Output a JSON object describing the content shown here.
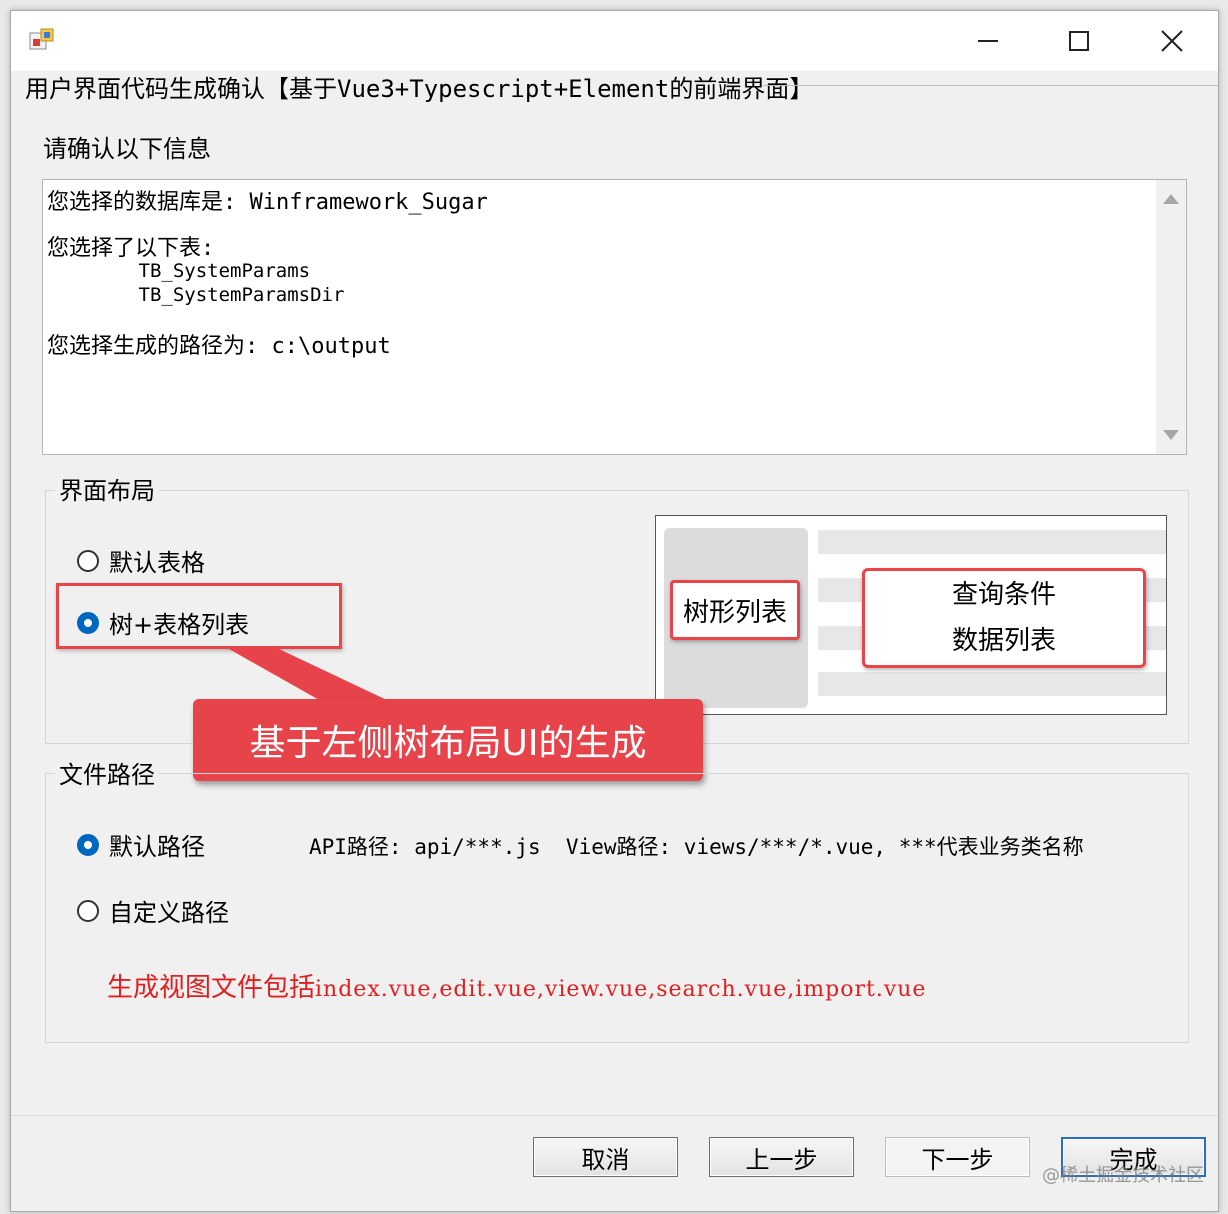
{
  "window": {
    "title_bar_title": "",
    "controls": {
      "minimize": "—",
      "maximize": "☐",
      "close": "✕"
    }
  },
  "header": {
    "title": "用户界面代码生成确认【基于Vue3+Typescript+Element的前端界面】"
  },
  "confirm": {
    "label": "请确认以下信息",
    "lines": [
      "您选择的数据库是: Winframework_Sugar",
      "您选择了以下表:",
      "        TB_SystemParams",
      "        TB_SystemParamsDir",
      "您选择生成的路径为: c:\\output"
    ]
  },
  "layout_group": {
    "legend": "界面布局",
    "options": [
      {
        "label": "默认表格",
        "checked": false
      },
      {
        "label": "树+表格列表",
        "checked": true
      }
    ],
    "callout": "基于左侧树布局UI的生成",
    "preview": {
      "tree_label": "树形列表",
      "main_line1": "查询条件",
      "main_line2": "数据列表"
    }
  },
  "path_group": {
    "legend": "文件路径",
    "options": [
      {
        "label": "默认路径",
        "checked": true
      },
      {
        "label": "自定义路径",
        "checked": false
      }
    ],
    "path_info": "API路径: api/***.js  View路径: views/***/*.vue, ***代表业务类名称",
    "note_prefix": "生成视图文件包括",
    "note_files": "index.vue,edit.vue,view.vue,search.vue,import.vue"
  },
  "buttons": {
    "cancel": "取消",
    "prev": "上一步",
    "next": "下一步",
    "finish": "完成"
  },
  "watermark": "@稀土掘金技术社区",
  "colors": {
    "accent_red": "#e6434a",
    "radio_blue": "#0067c0",
    "note_red": "#e02020"
  }
}
